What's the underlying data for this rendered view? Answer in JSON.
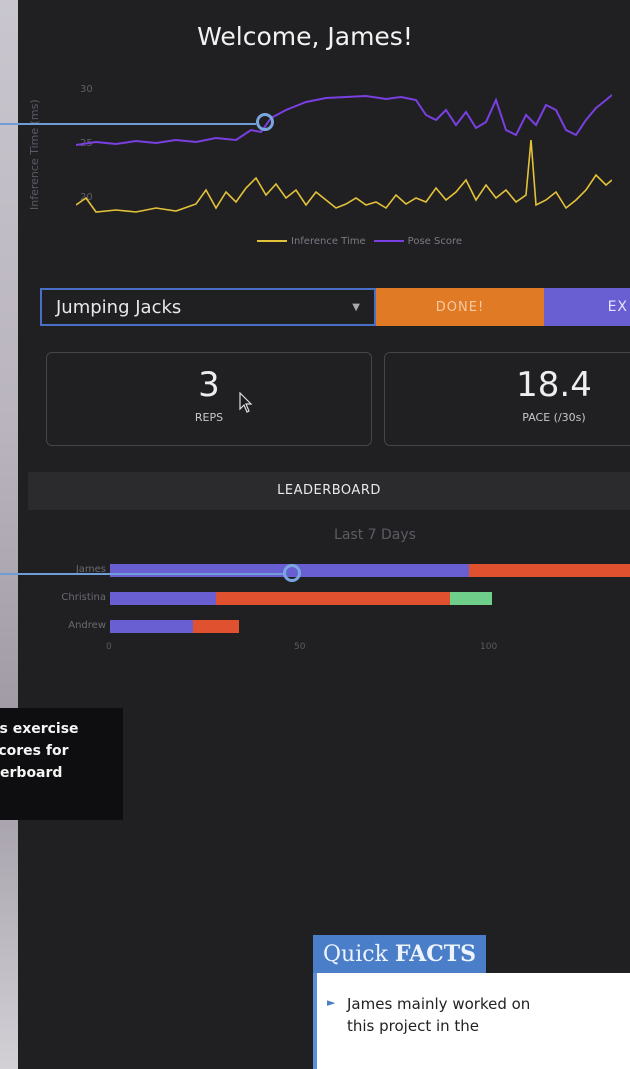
{
  "app": {
    "welcome": "Welcome, James!"
  },
  "chart": {
    "y_axis_label": "Inference Time (ms)",
    "y_ticks": [
      "30",
      "25",
      "20"
    ],
    "legend": [
      {
        "label": "Inference Time",
        "color": "#e3c23a"
      },
      {
        "label": "Pose Score",
        "color": "#7a3fe0"
      }
    ]
  },
  "controls": {
    "exercise_selected": "Jumping Jacks",
    "done_label": "DONE!",
    "ex_label": "EX"
  },
  "stats": [
    {
      "value": "3",
      "label": "REPS"
    },
    {
      "value": "18.4",
      "label": "PACE (/30s)"
    }
  ],
  "leaderboard": {
    "title": "LEADERBOARD",
    "subtitle": "Last 7 Days",
    "names": [
      "James",
      "Christina",
      "Andrew"
    ],
    "x_ticks": [
      "0",
      "50",
      "100"
    ]
  },
  "chart_data": {
    "type": "bar",
    "stacked": true,
    "orientation": "horizontal",
    "categories": [
      "James",
      "Christina",
      "Andrew"
    ],
    "series": [
      {
        "color": "#6a5fd2",
        "values": [
          95,
          28,
          22
        ]
      },
      {
        "color": "#e0512f",
        "values": [
          45,
          62,
          12
        ]
      },
      {
        "color": "#6fcf8a",
        "values": [
          0,
          11,
          0
        ]
      }
    ],
    "xlim": [
      0,
      140
    ],
    "x_ticks": [
      0,
      50,
      100
    ]
  },
  "caption": {
    "lines": [
      "es exercise",
      "scores for",
      "derboard"
    ]
  },
  "quick_facts": {
    "title_light": "Quick ",
    "title_bold": "FACTS",
    "bullet_text": "James mainly worked on this project in the"
  },
  "colors": {
    "accent_blue": "#4a7ec8",
    "orange": "#e07a25",
    "purple": "#6a5fd2"
  }
}
